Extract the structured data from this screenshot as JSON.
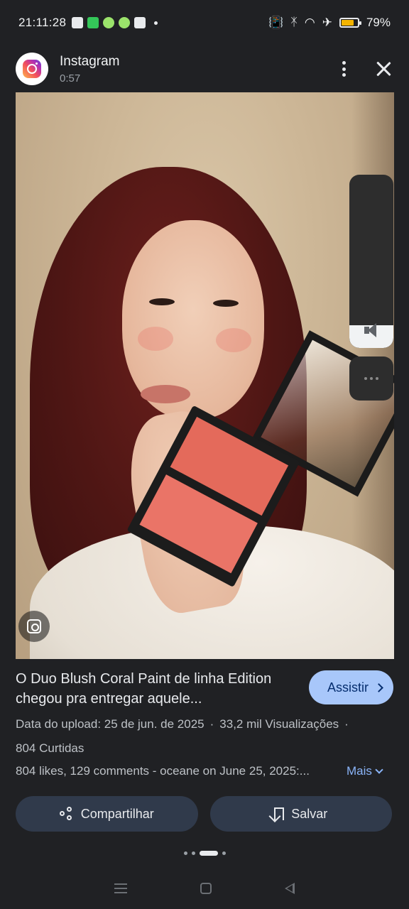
{
  "status_bar": {
    "time": "21:11:28",
    "battery_percent": "79%",
    "battery_level": 0.79,
    "icons": [
      "notification-icon",
      "notification-icon",
      "shield-icon",
      "shield-icon",
      "notification-icon",
      "vibrate-icon",
      "bluetooth-icon",
      "wifi-icon",
      "airplane-icon",
      "battery-icon"
    ]
  },
  "header": {
    "app_name": "Instagram",
    "duration": "0:57"
  },
  "volume": {
    "level": 0.13
  },
  "info": {
    "title": "O Duo Blush Coral Paint de linha Edition chegou pra entregar aquele...",
    "watch_label": "Assistir",
    "upload_date": "Data do upload: 25 de jun. de 2025",
    "separator": "·",
    "views": "33,2 mil Visualizações",
    "likes": "804 Curtidas",
    "description": "804 likes, 129 comments - oceane on June 25, 2025:...",
    "more_label": "Mais"
  },
  "actions": {
    "share_label": "Compartilhar",
    "save_label": "Salvar"
  },
  "colors": {
    "background": "#202124",
    "watch_button": "#a8c7fa",
    "action_button": "#303a4b",
    "link": "#8ab4f8"
  }
}
